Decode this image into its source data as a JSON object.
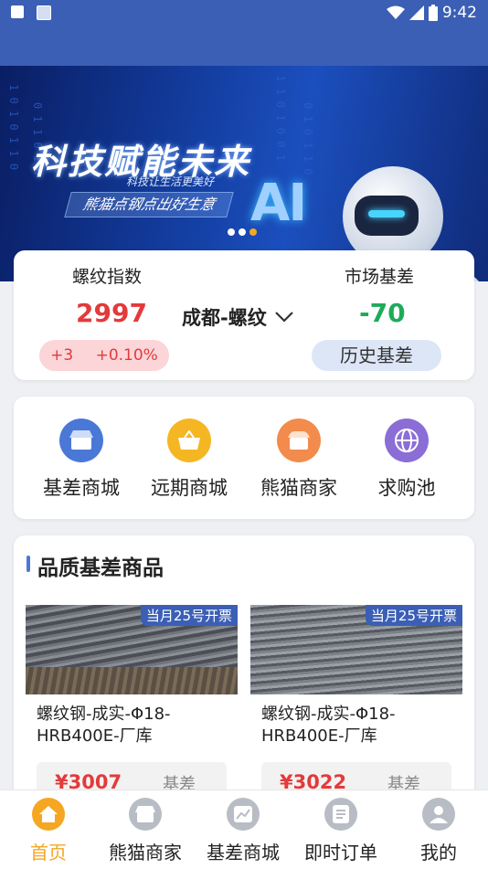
{
  "status_bar": {
    "time": "9:42"
  },
  "banner": {
    "title": "科技赋能未来",
    "subtitle": "科技让生活更美好",
    "tagline": "熊猫点钢点出好生意",
    "ai_text": "AI",
    "bits": [
      "1 0 1 0 1 1 0",
      "0 1 1 0 1 0",
      "1 1 0 1 0 0 1",
      "0 1 0 1 1 0"
    ],
    "carousel_count": 3,
    "carousel_active_index": 2
  },
  "index_card": {
    "left_label": "螺纹指数",
    "index_value": "2997",
    "change_abs": "+3",
    "change_pct": "+0.10%",
    "city_select": "成都-螺纹",
    "right_label": "市场基差",
    "basis_value": "-70",
    "history_button": "历史基差"
  },
  "quick_nav": [
    {
      "label": "基差商城",
      "icon": "store-icon",
      "color": "#4a78d6"
    },
    {
      "label": "远期商城",
      "icon": "basket-icon",
      "color": "#f5b623"
    },
    {
      "label": "熊猫商家",
      "icon": "shop-icon",
      "color": "#f28b4c"
    },
    {
      "label": "求购池",
      "icon": "globe-icon",
      "color": "#8a6ed6"
    }
  ],
  "goods_section": {
    "title": "品质基差商品",
    "products": [
      {
        "badge": "当月25号开票",
        "name": "螺纹钢-成实-Φ18-HRB400E-厂库",
        "price": "¥3007",
        "price_tag": "基差"
      },
      {
        "badge": "当月25号开票",
        "name": "螺纹钢-成实-Φ18-HRB400E-厂库",
        "price": "¥3022",
        "price_tag": "基差"
      }
    ]
  },
  "tabbar": [
    {
      "label": "首页",
      "icon": "home-icon",
      "active": true
    },
    {
      "label": "熊猫商家",
      "icon": "shop-icon",
      "active": false
    },
    {
      "label": "基差商城",
      "icon": "chart-icon",
      "active": false
    },
    {
      "label": "即时订单",
      "icon": "order-icon",
      "active": false
    },
    {
      "label": "我的",
      "icon": "user-icon",
      "active": false
    }
  ],
  "colors": {
    "brand_blue": "#3b5fb5",
    "up_red": "#e33a3a",
    "down_green": "#1faa5a",
    "accent_orange": "#f5a623"
  }
}
